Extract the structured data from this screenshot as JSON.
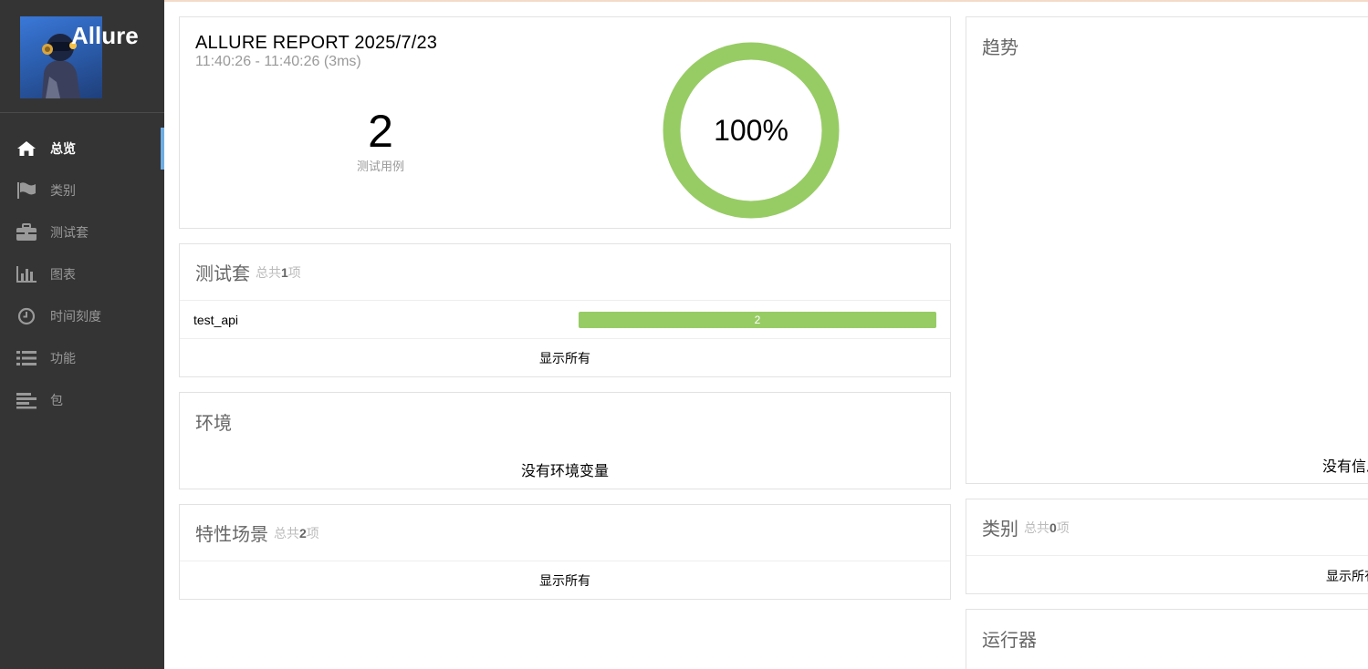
{
  "brand": {
    "title": "Allure"
  },
  "sidebar": {
    "items": [
      {
        "label": "总览",
        "icon": "home-icon",
        "active": true
      },
      {
        "label": "类别",
        "icon": "flag-icon",
        "active": false
      },
      {
        "label": "测试套",
        "icon": "briefcase-icon",
        "active": false
      },
      {
        "label": "图表",
        "icon": "bar-chart-icon",
        "active": false
      },
      {
        "label": "时间刻度",
        "icon": "clock-icon",
        "active": false
      },
      {
        "label": "功能",
        "icon": "list-icon",
        "active": false
      },
      {
        "label": "包",
        "icon": "align-left-icon",
        "active": false
      }
    ]
  },
  "summary": {
    "title": "ALLURE REPORT 2025/7/23",
    "time": "11:40:26 - 11:40:26 (3ms)",
    "count": "2",
    "count_label": "测试用例",
    "percent": "100%",
    "pass_fraction": 1.0,
    "ring_color": "#97cc64"
  },
  "suites": {
    "title": "测试套",
    "sub_prefix": "总共",
    "sub_count": "1",
    "sub_suffix": "项",
    "rows": [
      {
        "name": "test_api",
        "passed": "2"
      }
    ],
    "show_all": "显示所有"
  },
  "environment": {
    "title": "环境",
    "empty": "没有环境变量"
  },
  "features": {
    "title": "特性场景",
    "sub_prefix": "总共",
    "sub_count": "2",
    "sub_suffix": "项",
    "show_all": "显示所有"
  },
  "trend": {
    "title": "趋势",
    "empty": "没有信息"
  },
  "categories": {
    "title": "类别",
    "sub_prefix": "总共",
    "sub_count": "0",
    "sub_suffix": "项",
    "show_all": "显示所有"
  },
  "executors": {
    "title": "运行器"
  },
  "colors": {
    "sidebar_bg": "#343434",
    "passed": "#97cc64",
    "active_marker": "#6faee3"
  }
}
